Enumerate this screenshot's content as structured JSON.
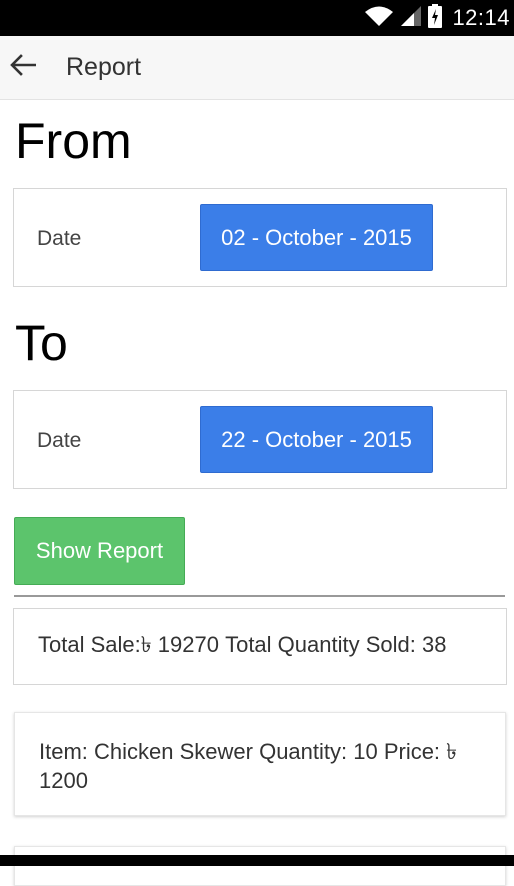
{
  "status_bar": {
    "time": "12:14",
    "icons": [
      "wifi-icon",
      "signal-icon",
      "battery-icon"
    ]
  },
  "app_bar": {
    "back_icon": "arrow-left-icon",
    "title": "Report"
  },
  "from_section": {
    "heading": "From",
    "date_label": "Date",
    "date_value": "02 - October - 2015"
  },
  "to_section": {
    "heading": "To",
    "date_label": "Date",
    "date_value": "22 - October - 2015"
  },
  "show_report_label": "Show Report",
  "summary": {
    "text": "Total Sale:৳ 19270 Total Quantity Sold: 38"
  },
  "items": [
    {
      "text": "Item: Chicken Skewer Quantity: 10 Price: ৳ 1200"
    }
  ],
  "colors": {
    "date_button": "#3b7ee8",
    "show_report_button": "#5cc46c",
    "status_bar": "#000000",
    "app_bar": "#f7f7f7"
  }
}
